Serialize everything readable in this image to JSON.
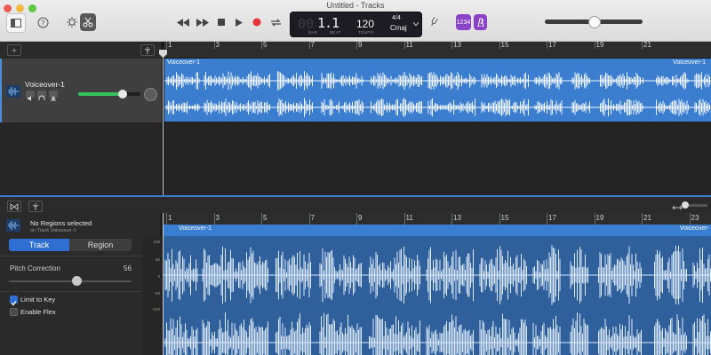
{
  "window": {
    "title": "Untitled - Tracks",
    "traffic_colors": [
      "#f05c55",
      "#f5b841",
      "#5cc742"
    ]
  },
  "toolbar": {
    "left_buttons": [
      {
        "name": "library",
        "icon": "library-icon"
      },
      {
        "name": "help",
        "icon": "help-icon"
      },
      {
        "name": "smart-controls",
        "icon": "knob-icon"
      },
      {
        "name": "editors",
        "icon": "scissors-icon"
      }
    ],
    "transport": [
      {
        "name": "rewind",
        "icon": "rewind-icon"
      },
      {
        "name": "fast-forward",
        "icon": "fast-forward-icon"
      },
      {
        "name": "stop",
        "icon": "stop-icon"
      },
      {
        "name": "play",
        "icon": "play-icon"
      },
      {
        "name": "record",
        "icon": "record-icon"
      },
      {
        "name": "cycle",
        "icon": "cycle-icon"
      }
    ],
    "lcd": {
      "bar": "1",
      "beat": "1",
      "bar_label": "BAR",
      "beat_label": "BEAT",
      "tempo": "120",
      "tempo_label": "TEMPO",
      "time_signature": "4/4",
      "key": "Cmaj"
    },
    "count_in_label": "1234",
    "master_volume": 0.45,
    "accent": "#8a43c6"
  },
  "ruler_top": {
    "ticks": [
      "1",
      "3",
      "5",
      "7",
      "9",
      "11",
      "13",
      "15",
      "17",
      "19",
      "21"
    ]
  },
  "track": {
    "name": "Voiceover-1",
    "icon": "waveform-icon",
    "controls": [
      "mute-icon",
      "headphones-icon",
      "input-icon"
    ],
    "volume": 0.8,
    "region_name": "Voiceover-1",
    "region_name_right": "Voiceover-1",
    "region_color": "#3b7ed0"
  },
  "editor": {
    "no_region_title": "No Regions selected",
    "no_region_subtitle": "on Track Voiceover-1",
    "tabs": [
      "Track",
      "Region"
    ],
    "active_tab": "Track",
    "pitch_correction_label": "Pitch Correction",
    "pitch_correction_value": "56",
    "limit_to_key_label": "Limit to Key",
    "limit_to_key_checked": true,
    "enable_flex_label": "Enable Flex",
    "enable_flex_checked": false,
    "ruler_ticks": [
      "1",
      "3",
      "5",
      "7",
      "9",
      "11",
      "13",
      "15",
      "17",
      "19",
      "21",
      "23"
    ],
    "region_name": "Voiceover-1",
    "region_name_right": "Voiceover-",
    "y_labels": [
      "100",
      "50",
      "0",
      "-50",
      "-100"
    ]
  }
}
